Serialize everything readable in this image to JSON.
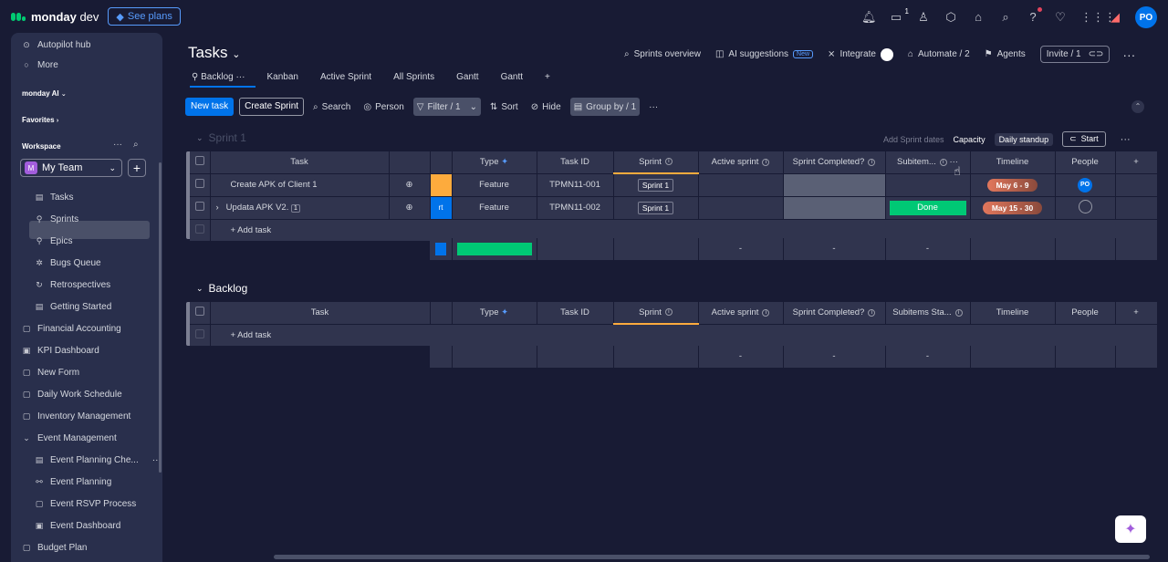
{
  "topbar": {
    "brand_bold": "monday",
    "brand_rest": " dev",
    "see_plans": "See plans",
    "inbox_count": "1",
    "avatar": "PO"
  },
  "sidebar": {
    "top_items": [
      "Autopilot hub",
      "More"
    ],
    "monday_ai": "monday AI",
    "favorites": "Favorites",
    "workspace": "Workspace",
    "team": "My Team",
    "team_initial": "M",
    "items": [
      "Tasks",
      "Sprints",
      "Epics",
      "Bugs Queue",
      "Retrospectives",
      "Getting Started",
      "Financial Accounting",
      "KPI Dashboard",
      "New Form",
      "Daily Work Schedule",
      "Inventory Management",
      "Event Management",
      "Event Planning Che...",
      "Event Planning",
      "Event RSVP Process",
      "Event Dashboard",
      "Budget Plan"
    ]
  },
  "header": {
    "title": "Tasks",
    "sprints_overview": "Sprints overview",
    "ai_suggestions": "AI suggestions",
    "new_label": "New",
    "integrate": "Integrate",
    "automate": "Automate / 2",
    "agents": "Agents",
    "invite": "Invite / 1"
  },
  "tabs": [
    "Backlog",
    "Kanban",
    "Active Sprint",
    "All Sprints",
    "Gantt",
    "Gantt"
  ],
  "toolbar": {
    "new_task": "New task",
    "create_sprint": "Create Sprint",
    "search": "Search",
    "person": "Person",
    "filter": "Filter / 1",
    "sort": "Sort",
    "hide": "Hide",
    "group_by": "Group by / 1"
  },
  "sprint_group": {
    "title": "Sprint 1",
    "add_dates": "Add Sprint dates",
    "capacity": "Capacity",
    "daily_standup": "Daily standup",
    "start": "Start",
    "columns": [
      "Task",
      "Type",
      "Task ID",
      "Sprint",
      "Active sprint",
      "Sprint Completed?",
      "Subitem...",
      "Timeline",
      "People"
    ],
    "rows": [
      {
        "task": "Create APK of Client 1",
        "type": "Feature",
        "task_id": "TPMN11-001",
        "sprint": "Sprint 1",
        "subitems": "",
        "timeline": "May 6 - 9",
        "people": "PO",
        "tag": ""
      },
      {
        "task": "Updata APK V2.",
        "count": "1",
        "type": "Feature",
        "task_id": "TPMN11-002",
        "sprint": "Sprint 1",
        "subitems": "Done",
        "timeline": "May 15 - 30",
        "people": "",
        "tag": "rt"
      }
    ],
    "add_task": "+ Add task",
    "summary_dash": "-"
  },
  "backlog_group": {
    "title": "Backlog",
    "columns": [
      "Task",
      "Type",
      "Task ID",
      "Sprint",
      "Active sprint",
      "Sprint Completed?",
      "Subitems Sta...",
      "Timeline",
      "People"
    ],
    "add_task": "+ Add task",
    "summary_dash": "-"
  }
}
